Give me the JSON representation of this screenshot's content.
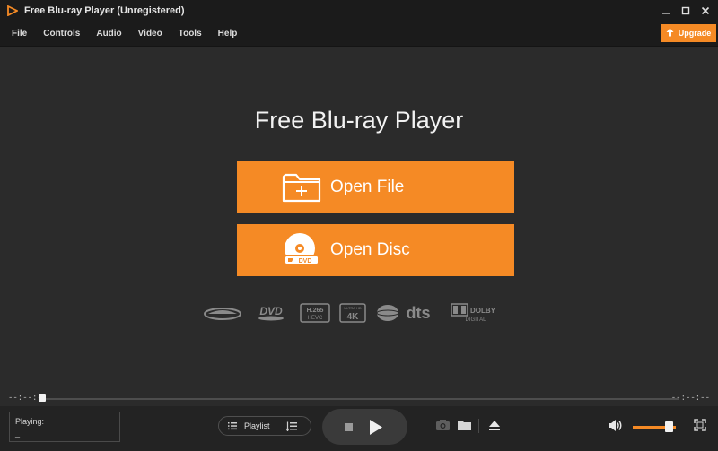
{
  "window": {
    "title": "Free Blu-ray Player (Unregistered)"
  },
  "menu": {
    "items": [
      {
        "label": "File"
      },
      {
        "label": "Controls"
      },
      {
        "label": "Audio"
      },
      {
        "label": "Video"
      },
      {
        "label": "Tools"
      },
      {
        "label": "Help"
      }
    ],
    "upgrade_label": "Upgrade"
  },
  "main": {
    "heading": "Free Blu-ray Player",
    "open_file_label": "Open File",
    "open_disc_label": "Open Disc",
    "format_logos": [
      {
        "name": "blu-ray"
      },
      {
        "name": "dvd"
      },
      {
        "name": "h265-hevc",
        "line1": "H.265",
        "line2": "HEVC"
      },
      {
        "name": "4k",
        "line1": "ULTRA HD",
        "line2": "4K"
      },
      {
        "name": "dts",
        "text": "dts"
      },
      {
        "name": "dolby-digital",
        "line1": "DOLBY",
        "line2": "DIGITAL"
      }
    ],
    "disc_icon_text": "DVD"
  },
  "progress": {
    "elapsed": "--:--:--",
    "total": "--:--:--",
    "position_fraction": 0.0
  },
  "bottom": {
    "playing_label": "Playing:",
    "playing_value": "_",
    "playlist_label": "Playlist",
    "volume_fraction": 0.75
  },
  "colors": {
    "accent": "#f58a25",
    "background": "#2b2b2b",
    "titlebar": "#1b1b1b"
  }
}
